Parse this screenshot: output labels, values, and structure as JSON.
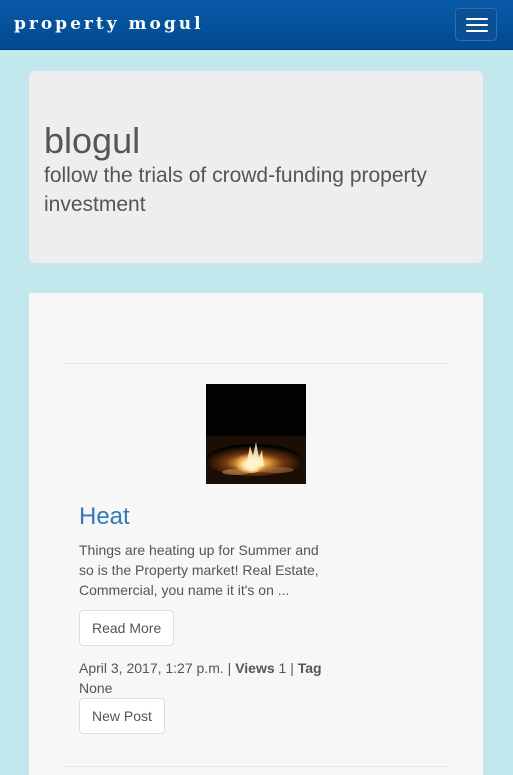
{
  "navbar": {
    "brand": "property mogul",
    "menu_icon": "hamburger-menu-icon"
  },
  "jumbotron": {
    "title": "blogul",
    "subtitle": "follow the trials of crowd-funding property investment"
  },
  "posts": [
    {
      "title": "Heat",
      "excerpt": "Things are heating up for Summer and so is the Property market! Real Estate, Commercial, you name it it's on ...",
      "read_more_label": "Read More",
      "date": "April 3, 2017, 1:27 p.m.",
      "sep1": "|",
      "views_label": "Views",
      "views_count": "1",
      "sep2": "|",
      "tag_label": "Tag",
      "tag_value": "None",
      "image_alt": "bonfire at night"
    }
  ],
  "actions": {
    "new_post_label": "New Post"
  },
  "colors": {
    "navbar": "#004a90",
    "page_background": "#c2e8ee",
    "jumbotron": "#eeeeee",
    "link": "#337ab7"
  }
}
